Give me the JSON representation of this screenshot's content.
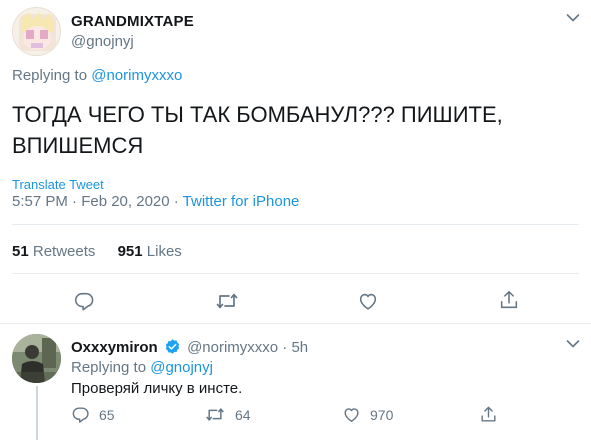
{
  "tweet": {
    "display_name": "GRANDMIXTAPE",
    "handle": "@gnojnyj",
    "replying_to_prefix": "Replying to",
    "replying_to_handle": "@norimyxxxo",
    "text_line1": "ТОГДА ЧЕГО ТЫ ТАК БОМБАНУЛ??? ПИШИТЕ,",
    "text_line2": "ВПИШЕМСЯ",
    "translate_label": "Translate Tweet",
    "time_date": "5:57 PM · Feb 20, 2020 · ",
    "source": "Twitter for iPhone",
    "retweets_count": "51",
    "retweets_label": "Retweets",
    "likes_count": "951",
    "likes_label": "Likes"
  },
  "reply": {
    "display_name": "Oxxxymiron",
    "handle_time": "@norimyxxxo · 5h",
    "replying_to_prefix": "Replying to",
    "replying_to_handle": "@gnojnyj",
    "text": "Проверяй личку в инсте.",
    "reply_count": "65",
    "retweet_count": "64",
    "like_count": "970"
  },
  "colors": {
    "accent": "#1b95e0",
    "muted": "#657786",
    "text": "#14171a",
    "verified": "#1da1f2",
    "divider": "#e6ecf0"
  },
  "icons": [
    "chevron-down-icon",
    "reply-icon",
    "retweet-icon",
    "like-icon",
    "share-icon",
    "verified-badge-icon"
  ]
}
